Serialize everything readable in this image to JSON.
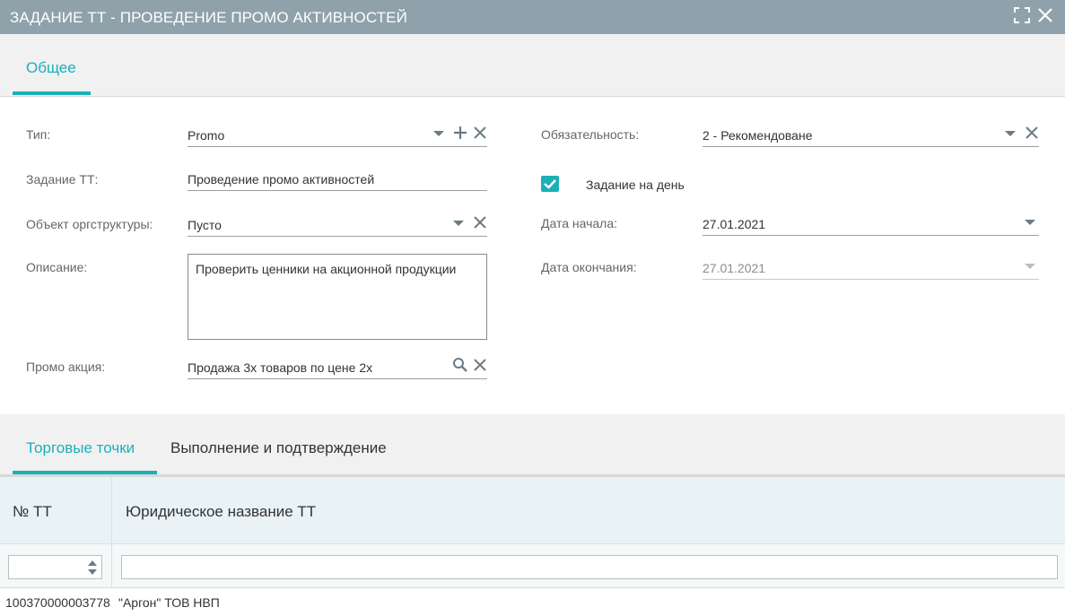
{
  "window": {
    "title": "ЗАДАНИЕ ТТ - ПРОВЕДЕНИЕ ПРОМО АКТИВНОСТЕЙ",
    "icons": [
      "expand-icon",
      "close-icon"
    ]
  },
  "top_tabs": [
    {
      "label": "Общее",
      "active": true
    }
  ],
  "form": {
    "left": {
      "type": {
        "label": "Тип:",
        "value": "Promo"
      },
      "task": {
        "label": "Задание ТТ:",
        "value": "Проведение промо активностей"
      },
      "org_object": {
        "label": "Объект оргструктуры:",
        "value": "Пусто"
      },
      "description": {
        "label": "Описание:",
        "value": "Проверить ценники на акционной продукции"
      },
      "promo": {
        "label": "Промо акция:",
        "value": "Продажа 3х товаров по цене 2х"
      }
    },
    "right": {
      "obligation": {
        "label": "Обязательность:",
        "value": "2 - Рекомендоване"
      },
      "daily_task": {
        "label": "Задание на день",
        "checked": true
      },
      "start_date": {
        "label": "Дата начала:",
        "value": "27.01.2021"
      },
      "end_date": {
        "label": "Дата окончания:",
        "value": "27.01.2021",
        "disabled": true
      }
    }
  },
  "bottom_tabs": [
    {
      "label": "Торговые точки",
      "active": true
    },
    {
      "label": "Выполнение и подтверждение",
      "active": false
    }
  ],
  "grid": {
    "columns": [
      "№ ТТ",
      "Юридическое название ТТ"
    ],
    "filters": {
      "number": "",
      "name": ""
    },
    "rows": [
      [
        "100370000003778",
        "\"Аргон\" ТОВ НВП"
      ]
    ]
  },
  "colors": {
    "accent": "#1cb0b7",
    "titlebar": "#8fa2ac"
  }
}
